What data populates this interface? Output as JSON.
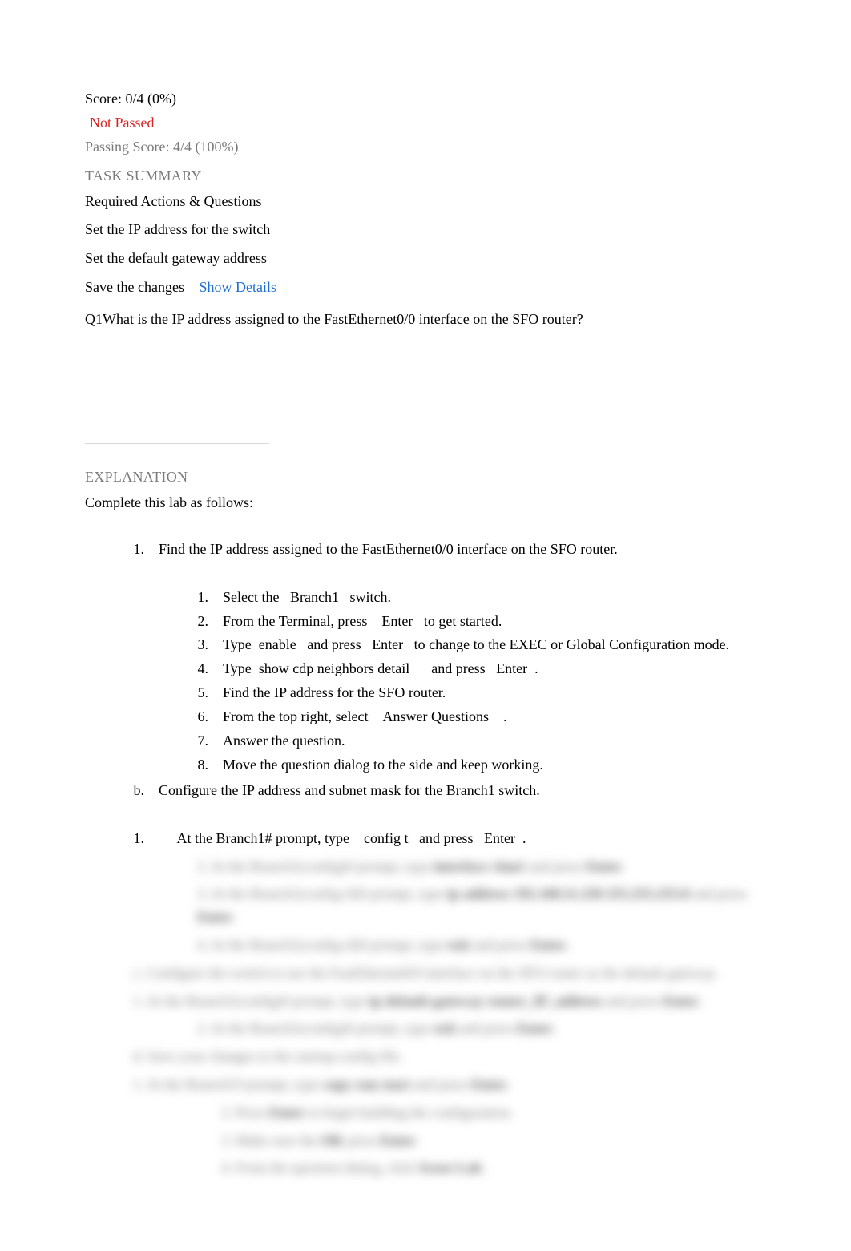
{
  "score_line": "Score: 0/4 (0%)",
  "not_passed": "Not Passed",
  "passing_score": "Passing Score: 4/4 (100%)",
  "task_summary": "TASK SUMMARY",
  "required_actions": "Required Actions & Questions",
  "actions": [
    "Set the IP address for the switch",
    "Set the default gateway address"
  ],
  "save_changes": "Save the changes",
  "show_details": "Show Details",
  "q_prefix": "Q1",
  "q_text": "What is the IP address assigned to the FastEthernet0/0 interface on the SFO router?",
  "explanation_heading": "EXPLANATION",
  "complete_lab": "Complete this lab as follows:",
  "step1": {
    "marker": "1.",
    "text": "Find the IP address assigned to the FastEthernet0/0 interface on the SFO router.",
    "sub": [
      {
        "marker": "1.",
        "text_a": "Select the ",
        "mid": "Branch1",
        "text_b": " switch."
      },
      {
        "marker": "2.",
        "text_a": "From the Terminal, press ",
        "mid": "Enter",
        "text_b": " to get started."
      },
      {
        "marker": "3.",
        "text_a": "Type ",
        "mid": "enable",
        "text_b": " and press ",
        "mid2": "Enter",
        "text_c": " to change to the EXEC or Global Configuration mode."
      },
      {
        "marker": "4.",
        "text_a": "Type ",
        "mid": "show cdp neighbors detail",
        "text_b": " and press ",
        "mid2": "Enter",
        "text_c": " ."
      },
      {
        "marker": "5.",
        "text_a": "Find the IP address for the SFO router."
      },
      {
        "marker": "6.",
        "text_a": "From the top right, select ",
        "mid": "Answer Questions",
        "text_b": " ."
      },
      {
        "marker": "7.",
        "text_a": "Answer the question."
      },
      {
        "marker": "8.",
        "text_a": "Move the question dialog to the side and keep working."
      }
    ]
  },
  "step_b": {
    "marker": "b.",
    "text": "Configure the IP address and subnet mask for the Branch1 switch."
  },
  "step_b1": {
    "marker": "1.",
    "text_a": "At the Branch1# prompt, type ",
    "mid": "config t",
    "text_b": " and press ",
    "mid2": "Enter",
    "text_c": " ."
  },
  "blurred": {
    "lines": [
      {
        "indent": 2,
        "marker": "2.",
        "body": "At the Branch1(config)# prompt, type ",
        "bold": "interface vlan1",
        "tail": " and press ",
        "bold2": "Enter",
        "tail2": "."
      },
      {
        "indent": 2,
        "marker": "3.",
        "body": "At the Branch1(config-if)# prompt, type ",
        "bold": "ip address 192.168.11.250 255.255.255.0",
        "tail": " and press ",
        "bold2": "Enter",
        "tail2": "."
      },
      {
        "indent": 2,
        "marker": "4.",
        "body": "At the Branch1(config-if)# prompt, type ",
        "bold": "exit",
        "tail": " and press ",
        "bold2": "Enter",
        "tail2": "."
      },
      {
        "indent": 1,
        "marker": "c.",
        "body": "Configure the switch to use the FastEthernet0/0 interface on the SFO router as the default gateway."
      },
      {
        "indent": 1,
        "marker": "1.",
        "body": "At the Branch1(config)# prompt, type ",
        "bold": "ip default-gateway router_IP_address",
        "tail": " and press ",
        "bold2": "Enter",
        "tail2": "."
      },
      {
        "indent": 2,
        "marker": "2.",
        "body": "At the Branch1(config)# prompt, type ",
        "bold": "exit",
        "tail": " and press ",
        "bold2": "Enter",
        "tail2": "."
      },
      {
        "indent": 1,
        "marker": "d.",
        "body": "Save your changes to the startup-config file."
      },
      {
        "indent": 1,
        "marker": "1.",
        "body": "At the Branch1# prompt, type ",
        "bold": "copy run start",
        "tail": " and press ",
        "bold2": "Enter",
        "tail2": "."
      },
      {
        "indent": 3,
        "marker": "2.",
        "body": "Press ",
        "bold": "Enter",
        "tail": " to begin building the configuration."
      },
      {
        "indent": 3,
        "marker": "3.",
        "body": "Make sure the ",
        "bold": "OK",
        "tail": " press ",
        "bold2": "Enter",
        "tail2": "."
      },
      {
        "indent": 3,
        "marker": "4.",
        "body": "From the question dialog, click ",
        "bold": "Score Lab",
        "tail": "."
      }
    ]
  }
}
